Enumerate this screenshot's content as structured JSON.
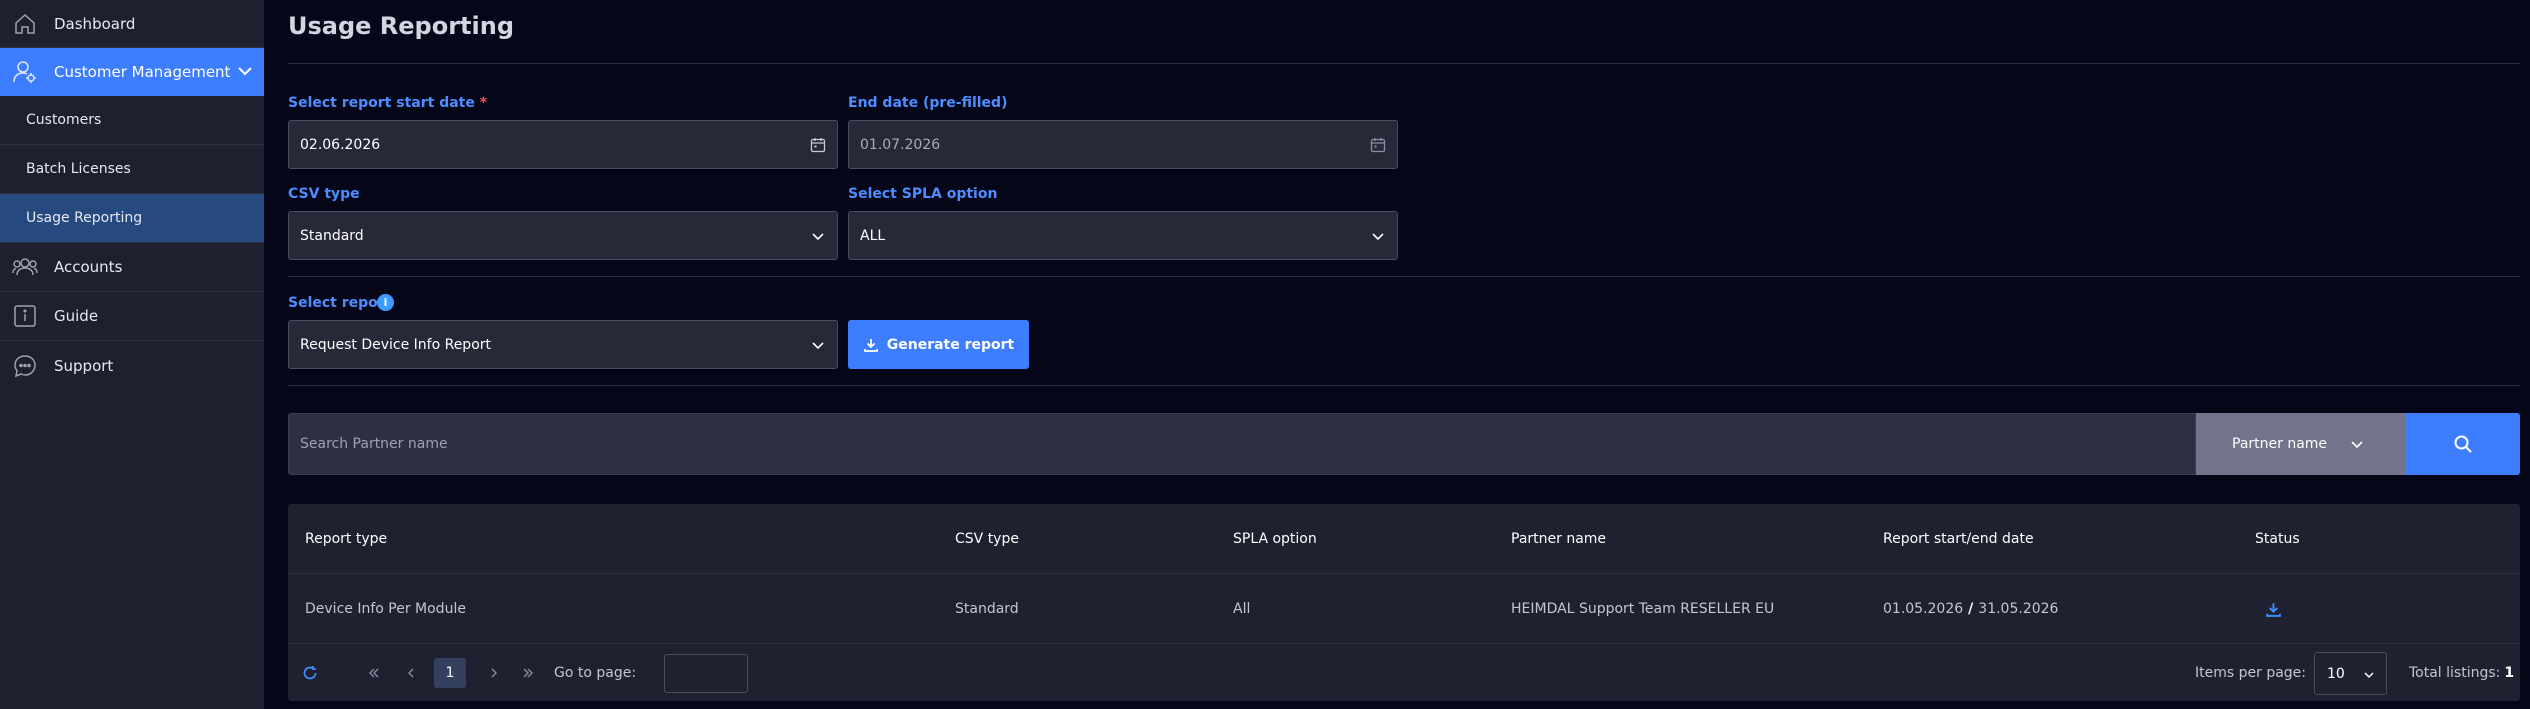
{
  "sidebar": {
    "dashboard": "Dashboard",
    "customer_management": "Customer Management",
    "sub_items": [
      "Customers",
      "Batch Licenses",
      "Usage Reporting"
    ],
    "accounts": "Accounts",
    "guide": "Guide",
    "support": "Support"
  },
  "page": {
    "title": "Usage Reporting"
  },
  "form": {
    "start_date_label": "Select report start date",
    "required_mark": "*",
    "start_date_value": "02.06.2026",
    "end_date_label": "End date (pre-filled)",
    "end_date_value": "01.07.2026",
    "csv_type_label": "CSV type",
    "csv_type_value": "Standard",
    "spla_label": "Select SPLA option",
    "spla_value": "ALL",
    "report_label": "Select report",
    "info_mark": "i",
    "report_value": "Request Device Info Report",
    "generate_label": "Generate report"
  },
  "search": {
    "placeholder": "Search Partner name",
    "filter_value": "Partner name"
  },
  "table": {
    "headers": [
      "Report type",
      "CSV type",
      "SPLA option",
      "Partner name",
      "Report start/end date",
      "Status"
    ],
    "rows": [
      {
        "report_type": "Device Info Per Module",
        "csv_type": "Standard",
        "spla": "All",
        "partner": "HEIMDAL Support Team RESELLER EU",
        "start": "01.05.2026",
        "separator": "/",
        "end": "31.05.2026"
      }
    ]
  },
  "pagination": {
    "current_page": "1",
    "goto_label": "Go to page:",
    "items_per_page_label": "Items per page:",
    "items_per_page": "10",
    "total_label": "Total listings:",
    "total": "1"
  },
  "colors": {
    "accent": "#3d7dff",
    "sidebar_bg": "#1e2030",
    "page_bg": "#050718",
    "selected": "#264a80"
  }
}
